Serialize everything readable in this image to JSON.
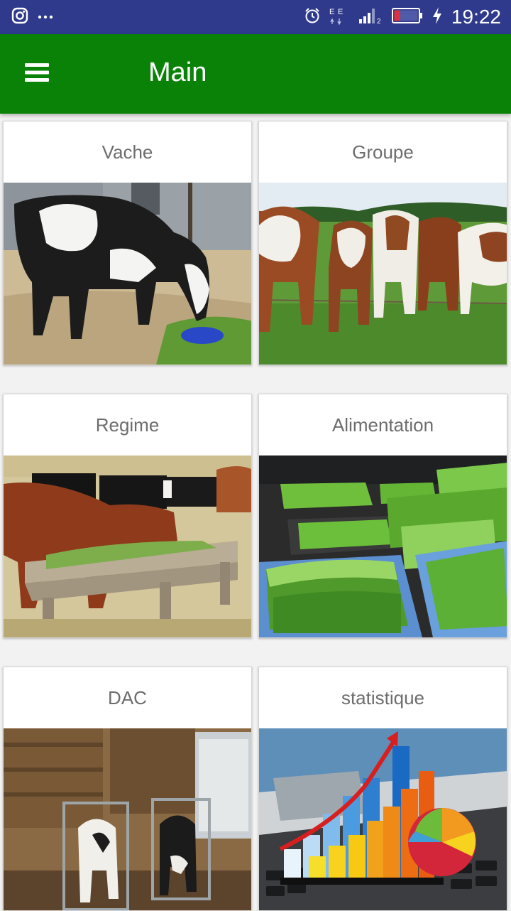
{
  "status_bar": {
    "time": "19:22",
    "icons": [
      "instagram-icon",
      "more-icon",
      "alarm-icon",
      "data-icon",
      "signal-icon",
      "battery-icon",
      "charging-icon"
    ]
  },
  "app_bar": {
    "title": "Main",
    "menu_icon": "hamburger-menu-icon"
  },
  "colors": {
    "status_bar": "#2f3a8c",
    "app_bar": "#0a8207",
    "card_title_text": "#6d6d6d"
  },
  "cards": [
    {
      "label": "Vache",
      "image": "holstein-cow-eating"
    },
    {
      "label": "Groupe",
      "image": "herd-of-cows-at-fence"
    },
    {
      "label": "Regime",
      "image": "cattle-at-feeder-trough"
    },
    {
      "label": "Alimentation",
      "image": "hydroponic-grass-trays"
    },
    {
      "label": "DAC",
      "image": "calves-in-pens"
    },
    {
      "label": "statistique",
      "image": "bar-chart-and-pie-chart"
    }
  ]
}
